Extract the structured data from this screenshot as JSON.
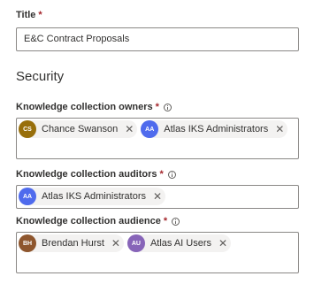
{
  "title_field": {
    "label": "Title",
    "required_mark": "*",
    "value": "E&C Contract Proposals"
  },
  "security": {
    "heading": "Security",
    "owners": {
      "label": "Knowledge collection owners",
      "required_mark": "*",
      "people": [
        {
          "initials": "CS",
          "name": "Chance Swanson",
          "color": "#986f0b"
        },
        {
          "initials": "AA",
          "name": "Atlas IKS Administrators",
          "color": "#4f6bed"
        }
      ]
    },
    "auditors": {
      "label": "Knowledge collection auditors",
      "required_mark": "*",
      "people": [
        {
          "initials": "AA",
          "name": "Atlas IKS Administrators",
          "color": "#4f6bed"
        }
      ]
    },
    "audience": {
      "label": "Knowledge collection audience",
      "required_mark": "*",
      "people": [
        {
          "initials": "BH",
          "name": "Brendan Hurst",
          "color": "#8e562e"
        },
        {
          "initials": "AU",
          "name": "Atlas AI Users",
          "color": "#8764b8"
        }
      ]
    }
  },
  "icons": {
    "info": "info-icon",
    "remove": "close-icon",
    "remove_glyph": "✕"
  }
}
